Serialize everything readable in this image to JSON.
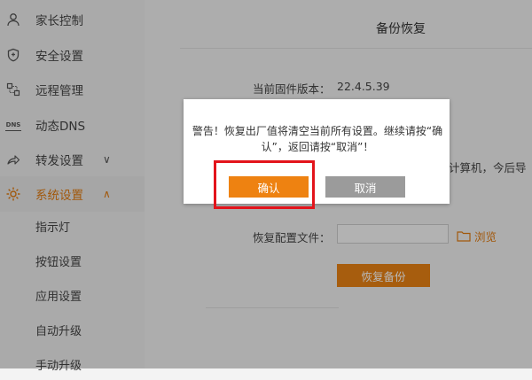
{
  "sidebar": {
    "items": [
      {
        "label": "家长控制",
        "icon": "parental-control-icon"
      },
      {
        "label": "安全设置",
        "icon": "shield-icon"
      },
      {
        "label": "远程管理",
        "icon": "remote-icon"
      },
      {
        "label": "动态DNS",
        "icon": "dns-icon",
        "icon_text": "DNS"
      },
      {
        "label": "转发设置",
        "icon": "share-icon",
        "chevron": "∨"
      },
      {
        "label": "系统设置",
        "icon": "gear-icon",
        "chevron": "∧",
        "active": true
      }
    ],
    "sub_items": [
      {
        "label": "指示灯"
      },
      {
        "label": "按钮设置"
      },
      {
        "label": "应用设置"
      },
      {
        "label": "自动升级"
      },
      {
        "label": "手动升级"
      }
    ]
  },
  "main": {
    "section_title": "备份恢复",
    "firmware_label": "当前固件版本：",
    "firmware_version": "22.4.5.39",
    "partial_text": "计算机，今后导",
    "restore_file_label": "恢复配置文件：",
    "restore_file_value": "",
    "browse_label": "浏览",
    "restore_button_label": "恢复备份"
  },
  "dialog": {
    "message": "警告！恢复出厂值将清空当前所有设置。继续请按“确认”，返回请按“取消”！",
    "confirm_label": "确认",
    "cancel_label": "取消"
  },
  "colors": {
    "accent": "#e88214",
    "highlight": "#e3141b",
    "cancel": "#9b9b9b"
  }
}
